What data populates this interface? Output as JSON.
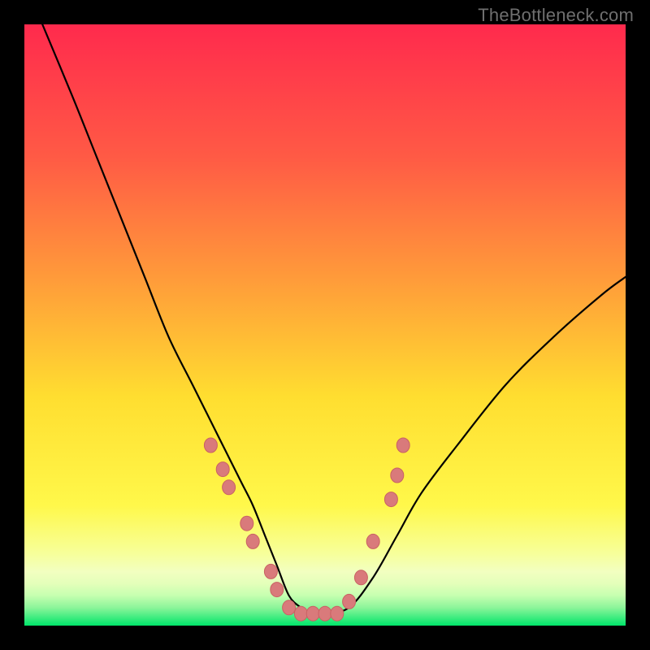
{
  "watermark": "TheBottleneck.com",
  "colors": {
    "frame": "#000000",
    "gradient_top": "#ff2a4d",
    "gradient_mid_upper": "#ff7a3a",
    "gradient_mid": "#ffde30",
    "gradient_lower": "#f7ff7a",
    "gradient_band1": "#f2ffb0",
    "gradient_band2": "#d3ffc0",
    "gradient_bottom": "#00e56a",
    "curve": "#000000",
    "marker_fill": "#d97a7b",
    "marker_stroke": "#c96263"
  },
  "chart_data": {
    "type": "line",
    "title": "",
    "xlabel": "",
    "ylabel": "",
    "xlim": [
      0,
      100
    ],
    "ylim": [
      0,
      100
    ],
    "grid": false,
    "legend": false,
    "series": [
      {
        "name": "curve",
        "x": [
          3,
          8,
          12,
          16,
          20,
          24,
          28,
          32,
          36,
          38,
          40,
          42,
          44,
          46,
          48,
          50,
          54,
          58,
          62,
          66,
          72,
          80,
          88,
          96,
          100
        ],
        "y": [
          100,
          88,
          78,
          68,
          58,
          48,
          40,
          32,
          24,
          20,
          15,
          10,
          5,
          3,
          2,
          2,
          3,
          8,
          15,
          22,
          30,
          40,
          48,
          55,
          58
        ]
      }
    ],
    "markers": [
      {
        "x": 31,
        "y": 30
      },
      {
        "x": 33,
        "y": 26
      },
      {
        "x": 34,
        "y": 23
      },
      {
        "x": 37,
        "y": 17
      },
      {
        "x": 38,
        "y": 14
      },
      {
        "x": 41,
        "y": 9
      },
      {
        "x": 42,
        "y": 6
      },
      {
        "x": 44,
        "y": 3
      },
      {
        "x": 46,
        "y": 2
      },
      {
        "x": 48,
        "y": 2
      },
      {
        "x": 50,
        "y": 2
      },
      {
        "x": 52,
        "y": 2
      },
      {
        "x": 54,
        "y": 4
      },
      {
        "x": 56,
        "y": 8
      },
      {
        "x": 58,
        "y": 14
      },
      {
        "x": 61,
        "y": 21
      },
      {
        "x": 62,
        "y": 25
      },
      {
        "x": 63,
        "y": 30
      }
    ]
  }
}
